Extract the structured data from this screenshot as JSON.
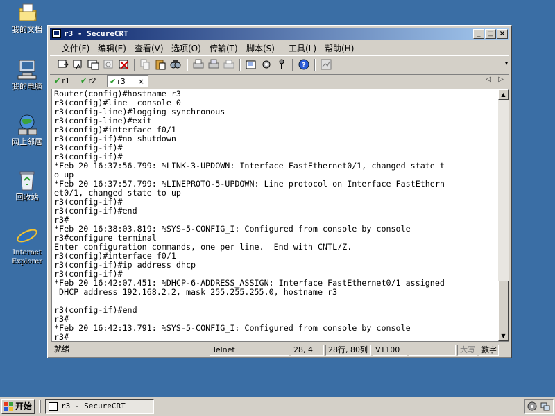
{
  "desktop": {
    "icons": [
      {
        "label": "我的文档",
        "icon": "my-documents-icon"
      },
      {
        "label": "我的电脑",
        "icon": "my-computer-icon"
      },
      {
        "label": "网上邻居",
        "icon": "network-places-icon"
      },
      {
        "label": "回收站",
        "icon": "recycle-bin-icon"
      },
      {
        "label": "Internet\nExplorer",
        "icon": "internet-explorer-icon"
      }
    ]
  },
  "window": {
    "title": "r3 - SecureCRT",
    "controls": {
      "minimize": "_",
      "maximize": "□",
      "close": "×"
    }
  },
  "menu": [
    "文件(F)",
    "编辑(E)",
    "查看(V)",
    "选项(O)",
    "传输(T)",
    "脚本(S)",
    "工具(L)",
    "帮助(H)"
  ],
  "tabs": [
    {
      "label": "r1",
      "active": false
    },
    {
      "label": "r2",
      "active": false
    },
    {
      "label": "r3",
      "active": true,
      "close": "×"
    }
  ],
  "terminal": {
    "lines": [
      "Router(config)#hostname r3",
      "r3(config)#line  console 0",
      "r3(config-line)#logging synchronous",
      "r3(config-line)#exit",
      "r3(config)#interface f0/1",
      "r3(config-if)#no shutdown",
      "r3(config-if)#",
      "r3(config-if)#",
      "*Feb 20 16:37:56.799: %LINK-3-UPDOWN: Interface FastEthernet0/1, changed state t",
      "o up",
      "*Feb 20 16:37:57.799: %LINEPROTO-5-UPDOWN: Line protocol on Interface FastEthern",
      "et0/1, changed state to up",
      "r3(config-if)#",
      "r3(config-if)#end",
      "r3#",
      "*Feb 20 16:38:03.819: %SYS-5-CONFIG_I: Configured from console by console",
      "r3#configure terminal",
      "Enter configuration commands, one per line.  End with CNTL/Z.",
      "r3(config)#interface f0/1",
      "r3(config-if)#ip address dhcp",
      "r3(config-if)#",
      "*Feb 20 16:42:07.451: %DHCP-6-ADDRESS_ASSIGN: Interface FastEthernet0/1 assigned",
      " DHCP address 192.168.2.2, mask 255.255.255.0, hostname r3",
      "",
      "r3(config-if)#end",
      "r3#",
      "*Feb 20 16:42:13.791: %SYS-5-CONFIG_I: Configured from console by console",
      "r3#"
    ]
  },
  "status": {
    "ready": "就绪",
    "protocol": "Telnet",
    "cursor": "28,  4",
    "size": "28行, 80列",
    "emulation": "VT100",
    "caps": "大写",
    "num": "数字"
  },
  "taskbar": {
    "start": "开始",
    "task": "r3 - SecureCRT"
  }
}
